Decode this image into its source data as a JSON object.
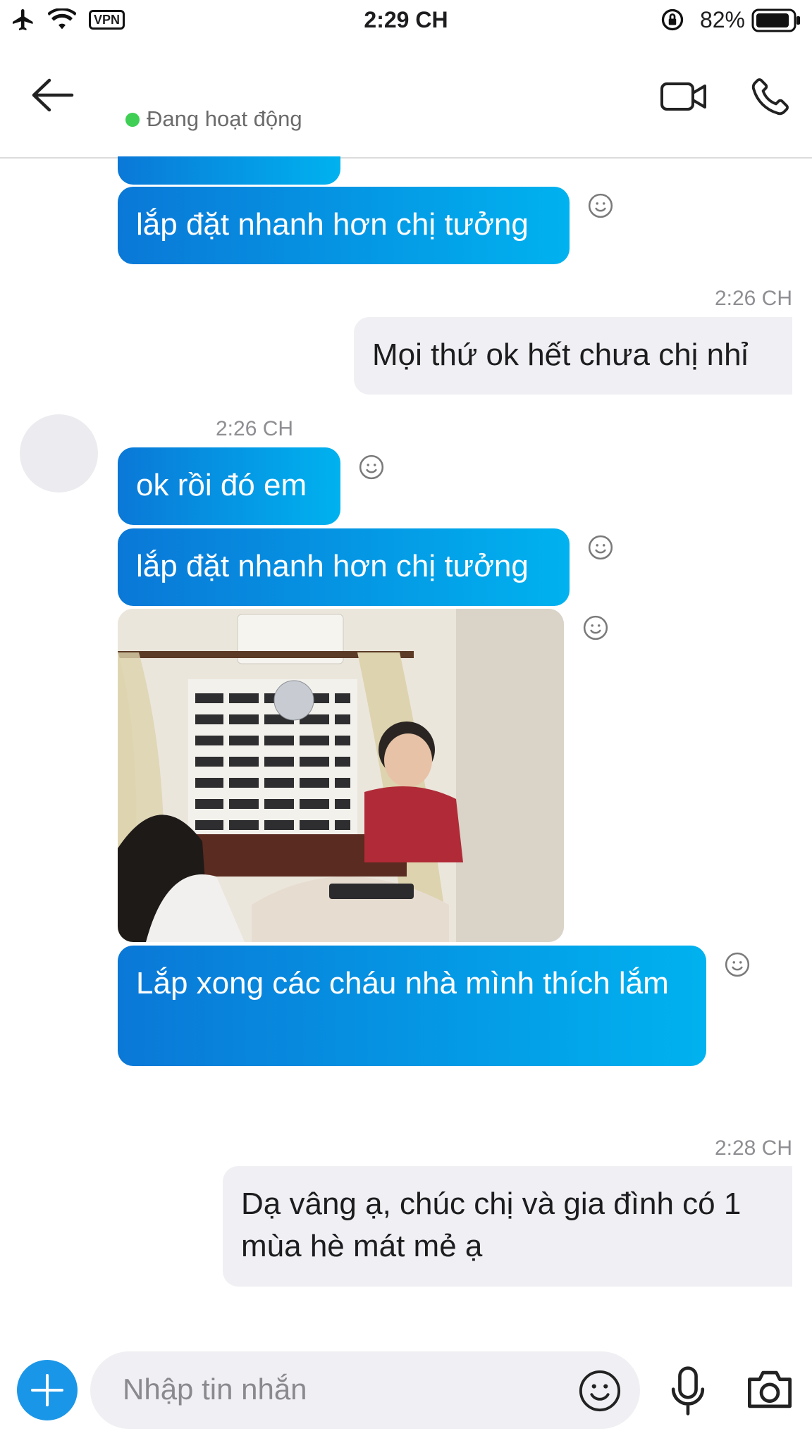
{
  "status_bar": {
    "time": "2:29 CH",
    "vpn": "VPN",
    "battery": "82%"
  },
  "header": {
    "presence": "Đang hoạt động"
  },
  "messages": [
    {
      "id": "m1",
      "text": "lắp đặt nhanh hơn chị tưởng"
    },
    {
      "id": "m2",
      "time": "2:26 CH",
      "text": "Mọi thứ ok hết chưa chị nhỉ"
    },
    {
      "id": "m3",
      "time": "2:26 CH",
      "text": "ok rồi đó em"
    },
    {
      "id": "m4",
      "text": "lắp đặt nhanh hơn chị tưởng"
    },
    {
      "id": "m5",
      "type": "photo"
    },
    {
      "id": "m6",
      "text": "Lắp xong các cháu nhà mình thích lắm"
    },
    {
      "id": "m7",
      "time": "2:28 CH",
      "text": "Dạ vâng ạ, chúc chị và gia đình có 1 mùa hè mát mẻ ạ"
    }
  ],
  "composer": {
    "placeholder": "Nhập tin nhắn"
  },
  "icons": {
    "back": "arrow-left-icon",
    "video": "video-call-icon",
    "call": "phone-icon",
    "react": "smiley-icon",
    "add": "plus-icon",
    "emoji": "emoji-icon",
    "mic": "microphone-icon",
    "camera": "camera-icon"
  },
  "colors": {
    "incoming_start": "#0a78d7",
    "incoming_end": "#00b2ef",
    "outgoing_bg": "#f0f0f4",
    "presence": "#3ecf54",
    "accent": "#1a96e8"
  }
}
